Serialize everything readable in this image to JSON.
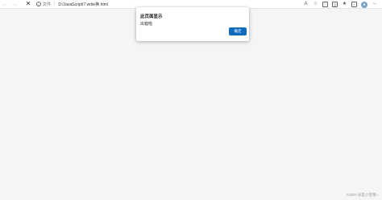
{
  "browser": {
    "address_bar": {
      "scheme_label": "文件",
      "separator": "|",
      "url": "D:/JavaScript/7.write换.html"
    },
    "icons": {
      "back": "back-arrow-icon",
      "forward": "forward-arrow-icon",
      "close": "close-icon",
      "info": "info-icon",
      "read_aloud": "read-aloud-icon",
      "favorite": "favorite-star-icon",
      "refresh_ext": "extension-icon",
      "split": "split-screen-icon",
      "favorites": "favorites-icon",
      "collections": "collections-icon",
      "profile": "profile-avatar-icon",
      "more": "more-menu-icon"
    }
  },
  "dialog": {
    "title": "此页面显示",
    "message": "出错啦",
    "ok_label": "确定",
    "accent_color": "#0f6cbd"
  },
  "watermark": {
    "text": "CSDN @是小曾哦~"
  }
}
